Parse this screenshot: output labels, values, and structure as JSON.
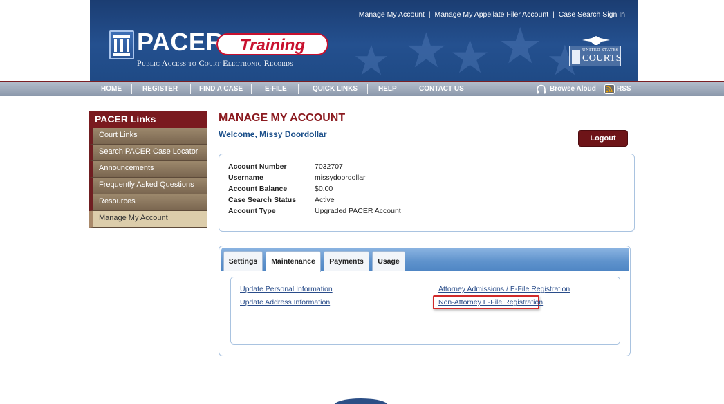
{
  "header": {
    "top_links": [
      "Manage My Account",
      "Manage My Appellate Filer Account",
      "Case Search Sign In"
    ],
    "top_links_separator": "|",
    "logo_word": "PACER",
    "logo_badge": "Training",
    "tagline": "Public Access to Court Electronic Records",
    "courts_logo_small": "UNITED STATES",
    "courts_logo_big": "COURTS"
  },
  "nav": {
    "items": [
      "HOME",
      "REGISTER",
      "FIND A CASE",
      "E-FILE",
      "QUICK LINKS",
      "HELP",
      "CONTACT US"
    ],
    "browse_aloud": "Browse Aloud",
    "rss": "RSS"
  },
  "sidebar": {
    "title": "PACER Links",
    "items": [
      {
        "label": "Court Links",
        "active": false
      },
      {
        "label": "Search PACER Case Locator",
        "active": false
      },
      {
        "label": "Announcements",
        "active": false
      },
      {
        "label": "Frequently Asked Questions",
        "active": false
      },
      {
        "label": "Resources",
        "active": false
      },
      {
        "label": "Manage My Account",
        "active": true
      }
    ]
  },
  "main": {
    "title": "MANAGE MY ACCOUNT",
    "welcome": "Welcome, Missy Doordollar",
    "logout_label": "Logout",
    "account": [
      {
        "label": "Account Number",
        "value": "7032707"
      },
      {
        "label": "Username",
        "value": "missydoordollar"
      },
      {
        "label": "Account Balance",
        "value": "$0.00"
      },
      {
        "label": "Case Search Status",
        "value": "Active"
      },
      {
        "label": "Account Type",
        "value": "Upgraded PACER Account"
      }
    ],
    "tabs": [
      {
        "label": "Settings",
        "active": false
      },
      {
        "label": "Maintenance",
        "active": true
      },
      {
        "label": "Payments",
        "active": false
      },
      {
        "label": "Usage",
        "active": false
      }
    ],
    "maintenance_links": {
      "left": [
        "Update Personal Information",
        "Update Address Information"
      ],
      "right": [
        "Attorney Admissions / E-File Registration",
        "Non-Attorney E-File Registration"
      ]
    }
  },
  "colors": {
    "brand_maroon": "#7a1a1f",
    "header_blue": "#24508f",
    "link_blue": "#2a4d8a",
    "highlight_red": "#d12a2a"
  }
}
